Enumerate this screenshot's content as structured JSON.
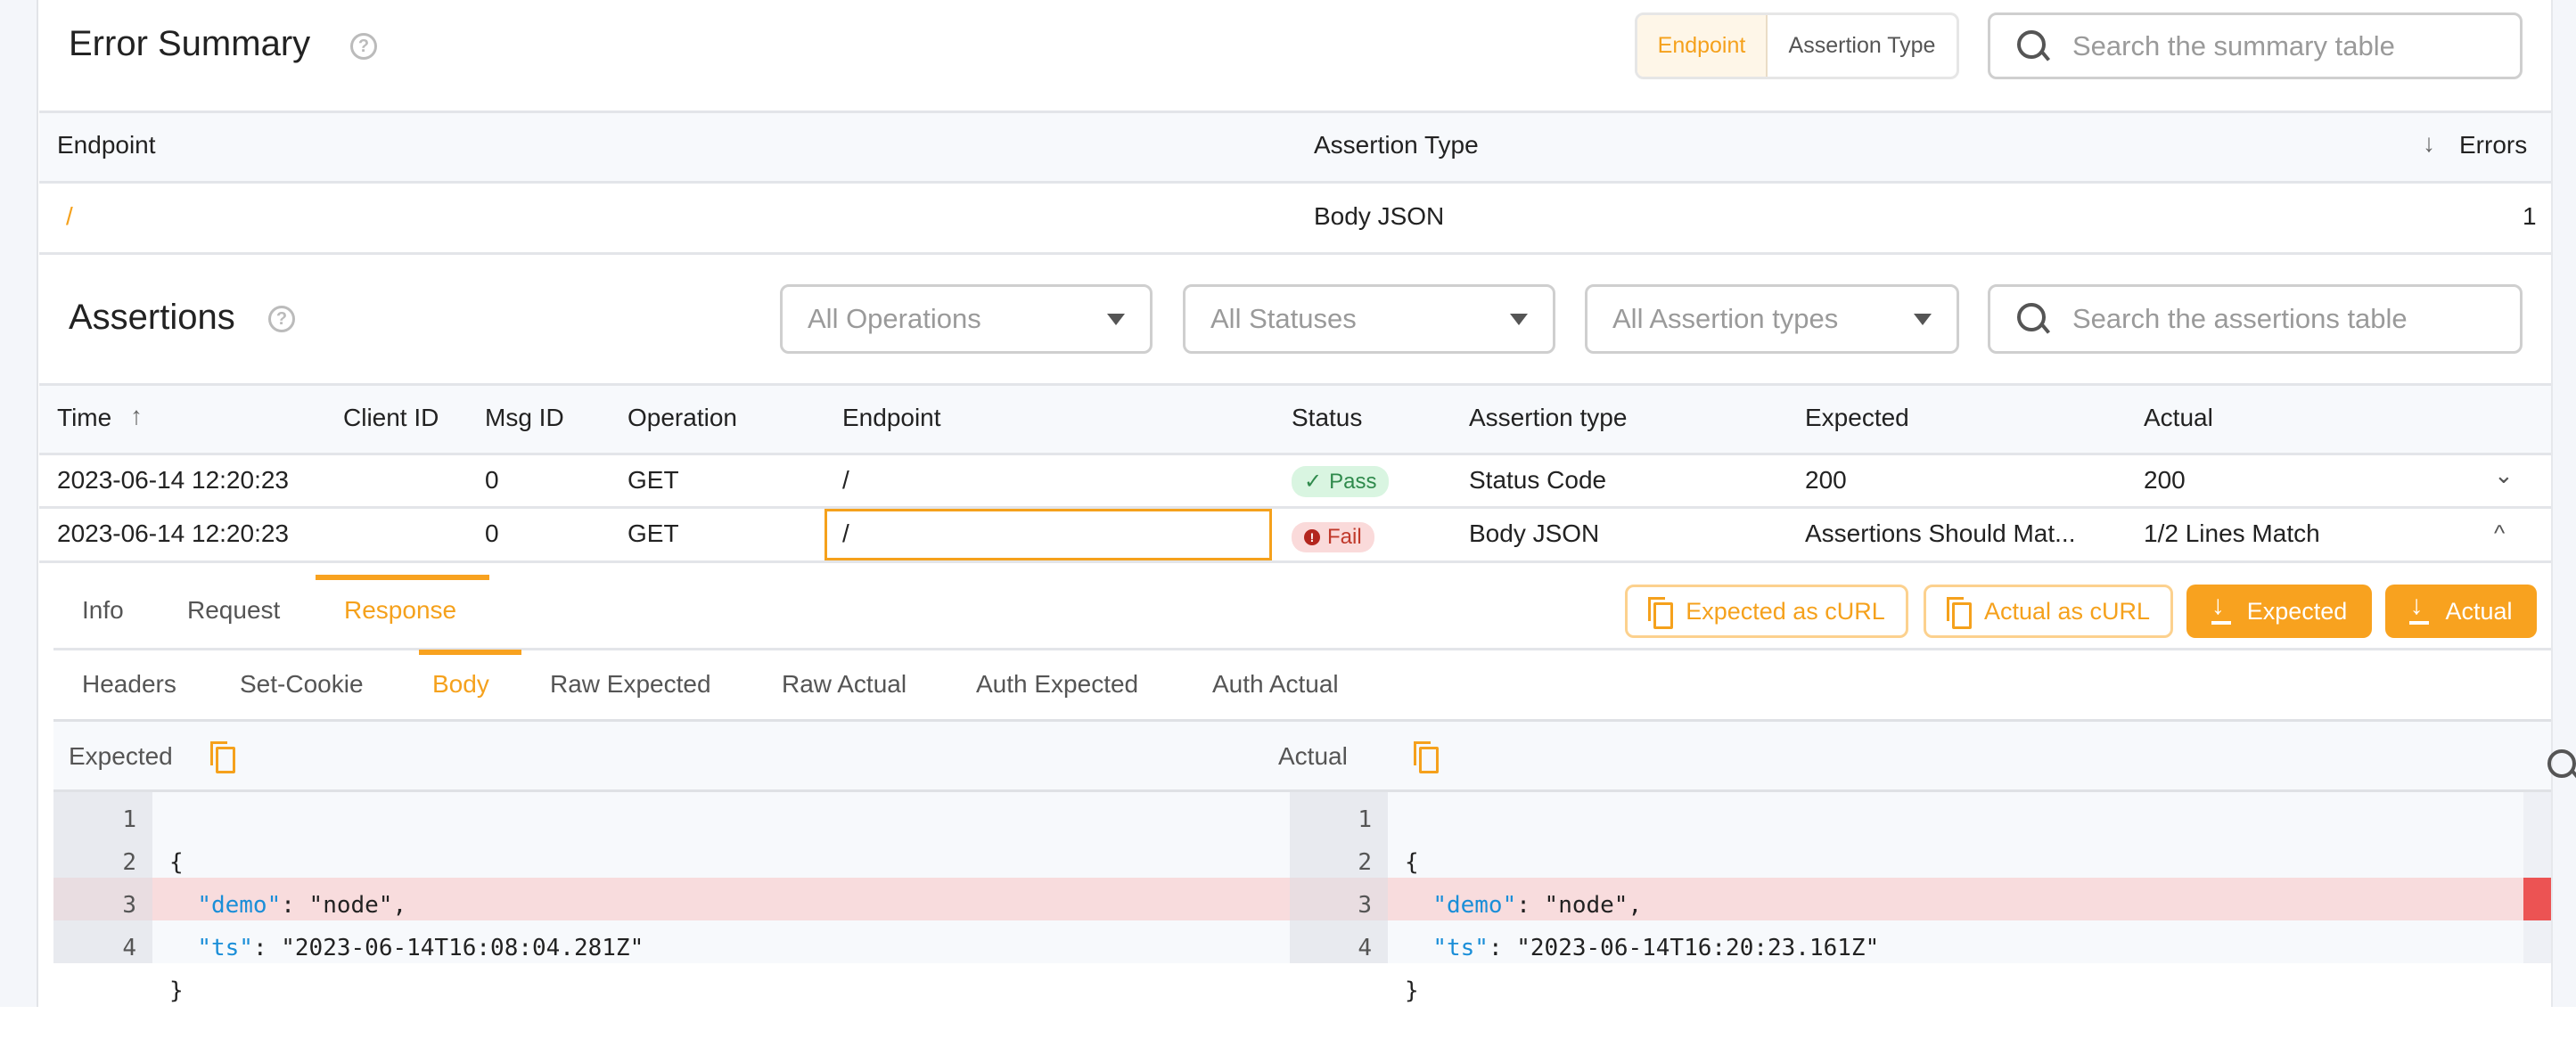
{
  "error_summary": {
    "title": "Error Summary",
    "help_icon": "question-circle-icon",
    "group_by": {
      "options": [
        "Endpoint",
        "Assertion Type"
      ],
      "selected": "Endpoint"
    },
    "search_placeholder": "Search the summary table",
    "columns": [
      "Endpoint",
      "Assertion Type",
      "Errors"
    ],
    "sort": {
      "column": "Errors",
      "direction": "descending"
    },
    "rows": [
      {
        "endpoint": "/",
        "assertion_type": "Body JSON",
        "errors": "1"
      }
    ]
  },
  "assertions": {
    "title": "Assertions",
    "filters": {
      "operations": "All Operations",
      "statuses": "All Statuses",
      "assertion_types": "All Assertion types"
    },
    "search_placeholder": "Search the assertions table",
    "columns": [
      "Time",
      "Client ID",
      "Msg ID",
      "Operation",
      "Endpoint",
      "Status",
      "Assertion type",
      "Expected",
      "Actual"
    ],
    "sort": {
      "column": "Time",
      "direction": "ascending"
    },
    "rows": [
      {
        "time": "2023-06-14 12:20:23",
        "client_id": "",
        "msg_id": "0",
        "operation": "GET",
        "endpoint": "/",
        "status": "Pass",
        "assertion_type": "Status Code",
        "expected": "200",
        "actual": "200",
        "expanded": false
      },
      {
        "time": "2023-06-14 12:20:23",
        "client_id": "",
        "msg_id": "0",
        "operation": "GET",
        "endpoint": "/",
        "status": "Fail",
        "assertion_type": "Body JSON",
        "expected": "Assertions Should Mat...",
        "actual": "1/2 Lines Match",
        "expanded": true
      }
    ]
  },
  "detail": {
    "tabs": [
      "Info",
      "Request",
      "Response"
    ],
    "active_tab": "Response",
    "buttons": {
      "expected_curl": "Expected as cURL",
      "actual_curl": "Actual as cURL",
      "download_expected": "Expected",
      "download_actual": "Actual"
    },
    "subtabs": [
      "Headers",
      "Set-Cookie",
      "Body",
      "Raw Expected",
      "Raw Actual",
      "Auth Expected",
      "Auth Actual"
    ],
    "active_subtab": "Body",
    "diff": {
      "expected_label": "Expected",
      "actual_label": "Actual",
      "line_numbers": [
        "1",
        "2",
        "3",
        "4"
      ],
      "expected": {
        "open": "{",
        "k1": "\"demo\"",
        "v1": ": \"node\",",
        "k2": "\"ts\"",
        "v2": ": \"2023-06-14T16:08:04.281Z\"",
        "close": "}"
      },
      "actual": {
        "open": "{",
        "k1": "\"demo\"",
        "v1": ": \"node\",",
        "k2": "\"ts\"",
        "v2": ": \"2023-06-14T16:20:23.161Z\"",
        "close": "}"
      },
      "changed_line": 3
    }
  },
  "colors": {
    "accent": "#f8a21f",
    "pass_bg": "#d9f5e1",
    "fail_bg": "#fadada",
    "diff_highlight": "#f8dcdd",
    "diff_marker": "#ec5353",
    "json_key": "#1a8ed8"
  }
}
